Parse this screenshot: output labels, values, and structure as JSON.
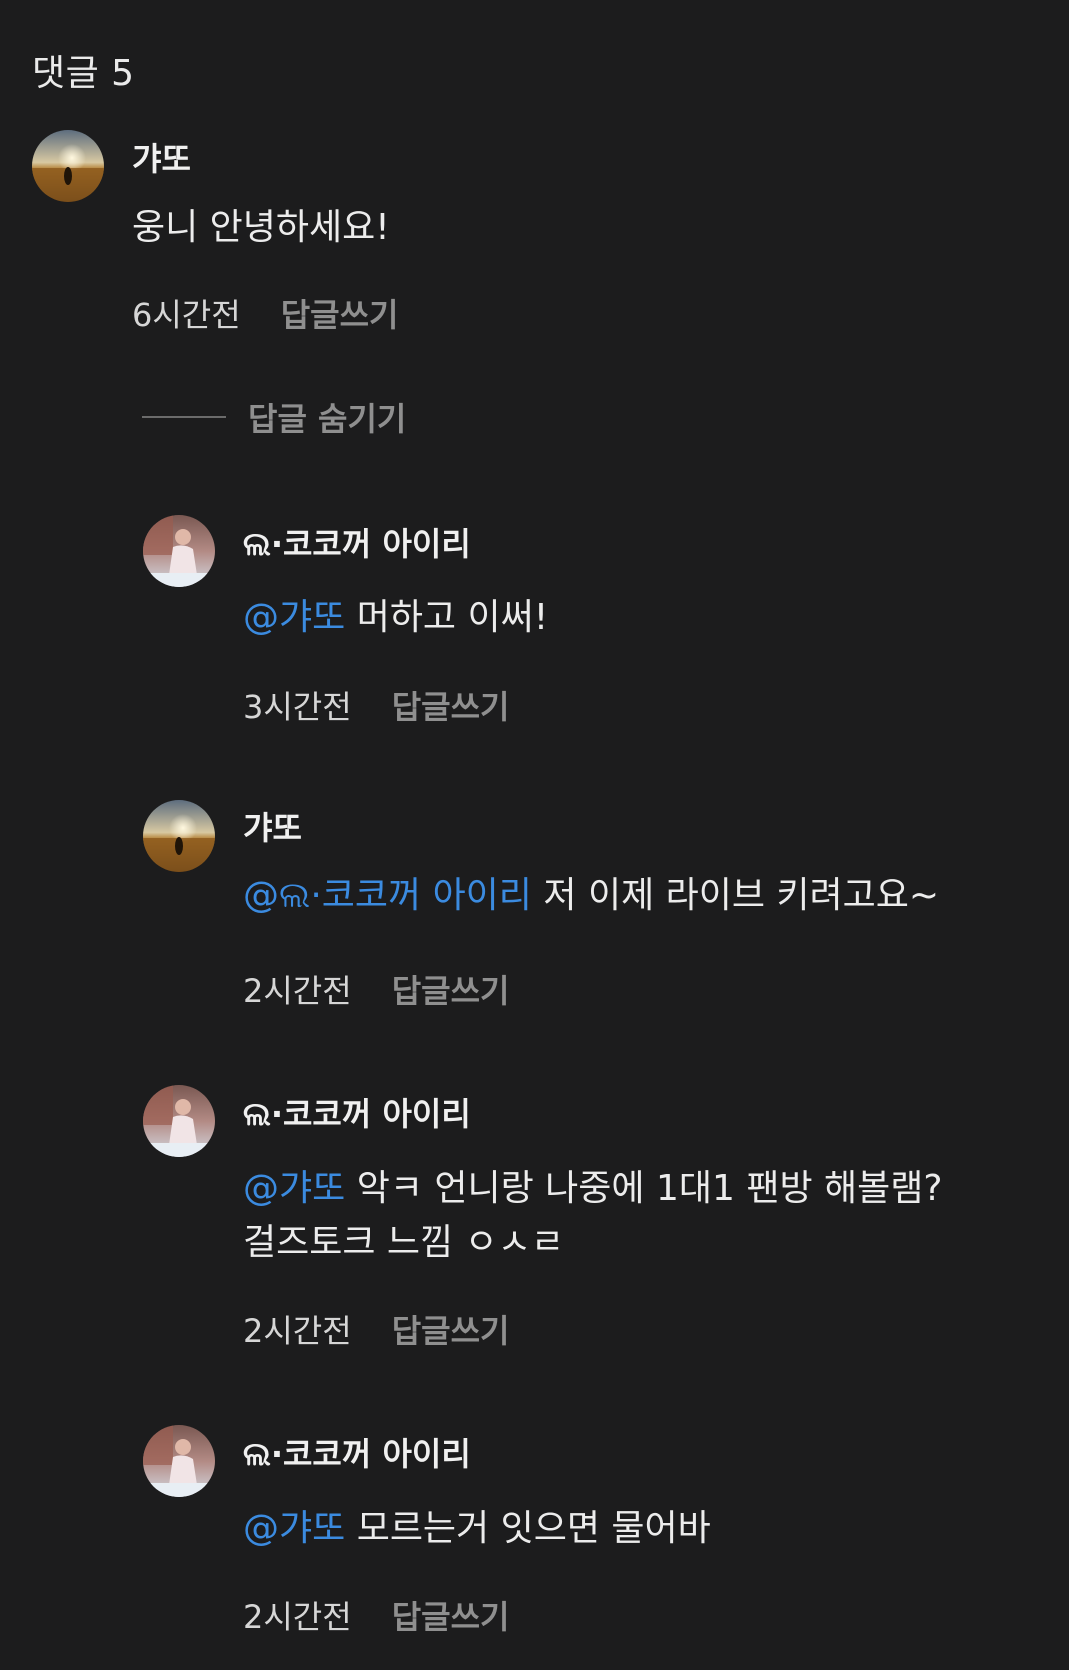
{
  "header": {
    "title": "댓글 5"
  },
  "top_comment": {
    "author": "갸또",
    "text": "웅니 안녕하세요!",
    "time": "6시간전",
    "reply_label": "답글쓰기"
  },
  "hide_replies_label": "답글 숨기기",
  "replies": [
    {
      "author": "ଲ·코코꺼 아이리",
      "avatar": "avatar-woman",
      "mention": "@갸또",
      "text": " 머하고 이써!",
      "text2": "",
      "time": "3시간전",
      "reply_label": "답글쓰기"
    },
    {
      "author": "갸또",
      "avatar": "avatar-field",
      "mention": "@ଲ·코코꺼 아이리",
      "text": " 저 이제 라이브 키려고요~",
      "text2": "",
      "time": "2시간전",
      "reply_label": "답글쓰기"
    },
    {
      "author": "ଲ·코코꺼 아이리",
      "avatar": "avatar-woman",
      "mention": "@갸또",
      "text": " 악ㅋ 언니랑 나중에 1대1 팬방 해볼램?",
      "text2": "걸즈토크 느낌 ㅇㅅㄹ",
      "time": "2시간전",
      "reply_label": "답글쓰기"
    },
    {
      "author": "ଲ·코코꺼 아이리",
      "avatar": "avatar-woman",
      "mention": "@갸또",
      "text": " 모르는거 잇으면 물어바",
      "text2": "",
      "time": "2시간전",
      "reply_label": "답글쓰기"
    }
  ],
  "colors": {
    "background": "#1c1c1d",
    "mention": "#3b8be0",
    "secondary": "#8f8f8f"
  }
}
